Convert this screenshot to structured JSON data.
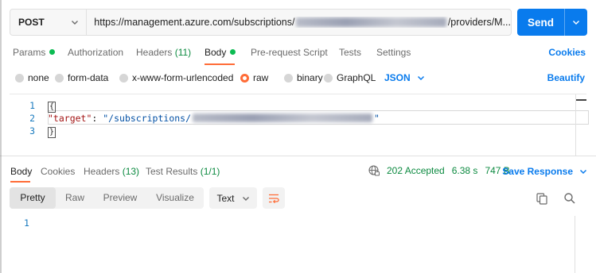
{
  "request": {
    "method": "POST",
    "url_prefix": "https://management.azure.com/subscriptions/",
    "url_suffix": "/providers/M...",
    "send_label": "Send"
  },
  "request_tabs": {
    "params": "Params",
    "authorization": "Authorization",
    "headers": "Headers",
    "headers_count": "(11)",
    "body": "Body",
    "pre_request": "Pre-request Script",
    "tests": "Tests",
    "settings": "Settings",
    "cookies": "Cookies"
  },
  "body_types": {
    "none": "none",
    "form_data": "form-data",
    "urlencoded": "x-www-form-urlencoded",
    "raw": "raw",
    "binary": "binary",
    "graphql": "GraphQL",
    "format": "JSON",
    "beautify": "Beautify"
  },
  "editor": {
    "line_numbers": [
      "1",
      "2",
      "3"
    ],
    "open_brace": "{",
    "key": "\"target\"",
    "colon": ": ",
    "value_prefix": "\"/subscriptions/",
    "value_suffix": "\"",
    "close_brace": "}"
  },
  "response_tabs": {
    "body": "Body",
    "cookies": "Cookies",
    "headers": "Headers",
    "headers_count": "(13)",
    "test_results": "Test Results",
    "test_results_count": "(1/1)",
    "status": "202 Accepted",
    "time": "6.38 s",
    "size": "747 B",
    "save_response": "Save Response"
  },
  "response_toolbar": {
    "pretty": "Pretty",
    "raw": "Raw",
    "preview": "Preview",
    "visualize": "Visualize",
    "text_format": "Text"
  },
  "response_body": {
    "line_numbers": [
      "1"
    ]
  },
  "colors": {
    "accent": "#ff6c37",
    "primary": "#097bed",
    "success": "#0cbb52"
  }
}
